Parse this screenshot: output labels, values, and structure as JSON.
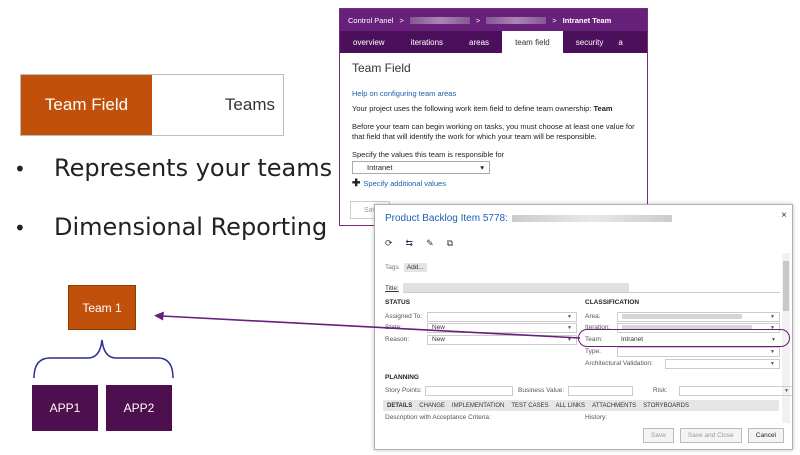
{
  "slide": {
    "tab_active": "Team Field",
    "tab_inactive": "Teams",
    "bullets": [
      "Represents your teams",
      "Dimensional Reporting"
    ],
    "team_box": "Team 1",
    "apps": [
      "APP1",
      "APP2"
    ],
    "bullet_char": "•",
    "colors": {
      "orange": "#c0500a",
      "purple": "#4e0f4f",
      "arrow": "#68217a"
    }
  },
  "control_panel": {
    "breadcrumb_start": "Control Panel",
    "breadcrumb_sep": ">",
    "breadcrumb_end": "Intranet Team",
    "tabs": [
      "overview",
      "iterations",
      "areas",
      "team field",
      "security",
      "a"
    ],
    "active_tab": "team field",
    "title": "Team Field",
    "help_link": "Help on configuring team areas",
    "ownership_text": "Your project uses the following work item field to define team ownership:",
    "ownership_field": "Team",
    "instructions": "Before your team can begin working on tasks, you must choose at least one value for that field that will identify the work for which your team will be responsible.",
    "values_label": "Specify the values this team is responsible for",
    "selected_value": "Intranet",
    "add_values_link": "Specify additional values",
    "save_label": "Sav"
  },
  "work_item": {
    "title_prefix": "Product Backlog Item 5778:",
    "close_glyph": "×",
    "tool_icons": [
      "⟳",
      "⇆",
      "✎",
      "⧉"
    ],
    "tags_label": "Tags",
    "add_tag": "Add...",
    "title_label": "Title:",
    "status_heading": "STATUS",
    "assigned_label": "Assigned To:",
    "state_label": "State:",
    "state_value": "New",
    "reason_label": "Reason:",
    "reason_value": "New",
    "classification_heading": "CLASSIFICATION",
    "area_label": "Area:",
    "iteration_label": "Iteration:",
    "team_label": "Team:",
    "team_value": "Intranet",
    "type_label": "Type:",
    "arch_label": "Architectural Validation:",
    "planning_heading": "PLANNING",
    "story_points_label": "Story Points:",
    "business_value_label": "Business Value:",
    "risk_label": "Risk:",
    "detail_tabs": [
      "DETAILS",
      "CHANGE",
      "IMPLEMENTATION",
      "TEST CASES",
      "ALL LINKS",
      "ATTACHMENTS",
      "STORYBOARDS"
    ],
    "description_label": "Description with Acceptance Criteria:",
    "history_label": "History:",
    "buttons": {
      "save": "Save",
      "save_close": "Save and Close",
      "cancel": "Cancel"
    }
  }
}
